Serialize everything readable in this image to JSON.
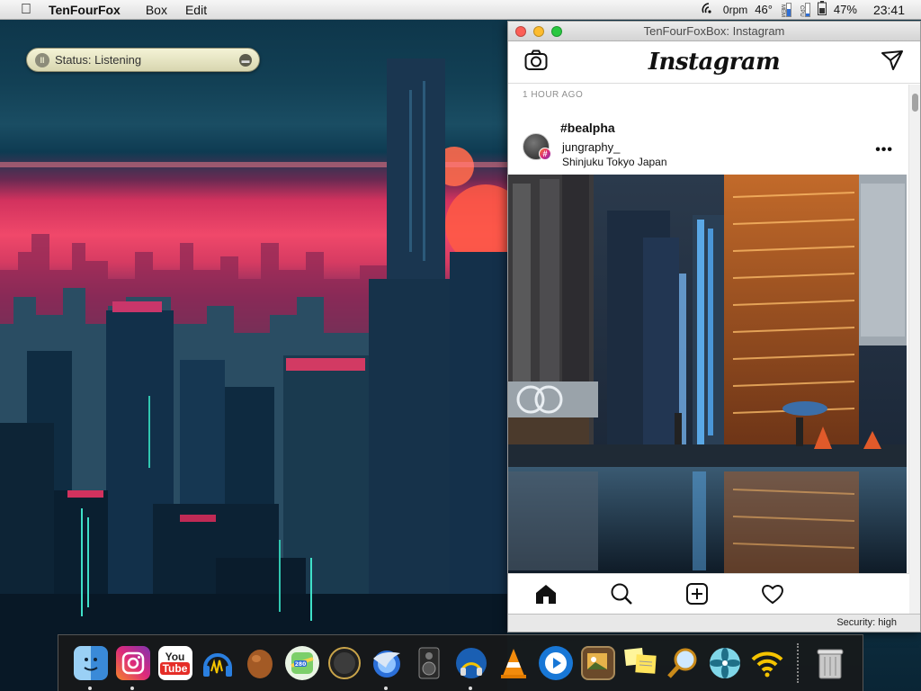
{
  "menubar": {
    "app_name": "TenFourFox",
    "menus": [
      "Box",
      "Edit"
    ],
    "fan": "0rpm",
    "temp": "46°",
    "mem_label": "MEM",
    "cpu_label": "CPU",
    "mem_level": 0.55,
    "cpu_level": 0.15,
    "battery": "47%",
    "clock": "23:41"
  },
  "status_widget": {
    "text": "Status: Listening"
  },
  "window": {
    "title": "TenFourFoxBox: Instagram",
    "logo": "Instagram",
    "time_ago": "1 HOUR AGO",
    "post": {
      "hashtag": "#bealpha",
      "username": "jungraphy_",
      "location": "Shinjuku Tokyo Japan",
      "badge": "#",
      "more": "•••"
    },
    "security": "Security: high"
  },
  "dock": {
    "items": [
      {
        "name": "finder",
        "label": ""
      },
      {
        "name": "instagram",
        "label": ""
      },
      {
        "name": "youtube",
        "label": "You Tube"
      },
      {
        "name": "audio",
        "label": ""
      },
      {
        "name": "potato",
        "label": ""
      },
      {
        "name": "maps",
        "label": "280"
      },
      {
        "name": "sphere",
        "label": ""
      },
      {
        "name": "tenfourfox",
        "label": ""
      },
      {
        "name": "speaker",
        "label": ""
      },
      {
        "name": "podcast",
        "label": ""
      },
      {
        "name": "vlc",
        "label": ""
      },
      {
        "name": "player",
        "label": ""
      },
      {
        "name": "preview",
        "label": ""
      },
      {
        "name": "stickies",
        "label": ""
      },
      {
        "name": "magnifier",
        "label": ""
      },
      {
        "name": "fan",
        "label": ""
      },
      {
        "name": "wifi",
        "label": ""
      },
      {
        "name": "trash",
        "label": ""
      }
    ]
  },
  "colors": {
    "accent_pink": "#f0486a",
    "teal": "#1a4d63"
  }
}
